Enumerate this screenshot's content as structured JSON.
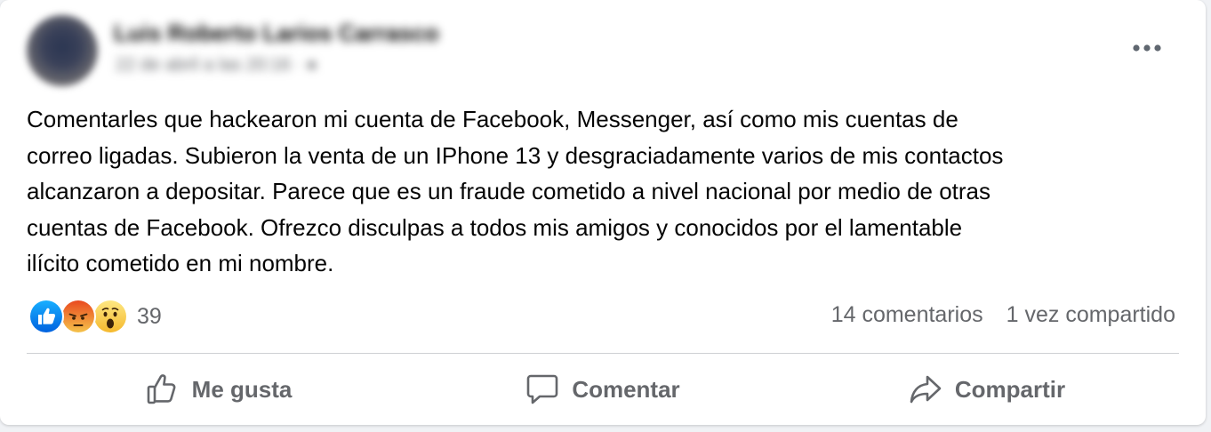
{
  "post": {
    "author_name": "Luis Roberto Larios Carrasco",
    "meta": "22 de abril a las 20:16 · ",
    "text": "Comentarles que hackearon mi cuenta de Facebook, Messenger, así como mis cuentas de\ncorreo ligadas. Subieron la venta de un IPhone 13 y desgraciadamente varios de mis contactos\nalcanzaron a depositar. Parece que es un fraude cometido a nivel nacional por medio de otras\ncuentas de Facebook. Ofrezco disculpas a todos mis amigos y conocidos por el lamentable\nilícito cometido en mi nombre."
  },
  "reactions": {
    "types": [
      "like-icon",
      "angry-icon",
      "wow-icon"
    ],
    "count": "39"
  },
  "stats": {
    "comments": "14 comentarios",
    "shares": "1 vez compartido"
  },
  "actions": {
    "like": "Me gusta",
    "comment": "Comentar",
    "share": "Compartir"
  },
  "colors": {
    "like_blue": "#1877f2",
    "angry_orange": "#f0641e",
    "wow_yellow": "#f7c940",
    "secondary_text": "#65676b"
  }
}
